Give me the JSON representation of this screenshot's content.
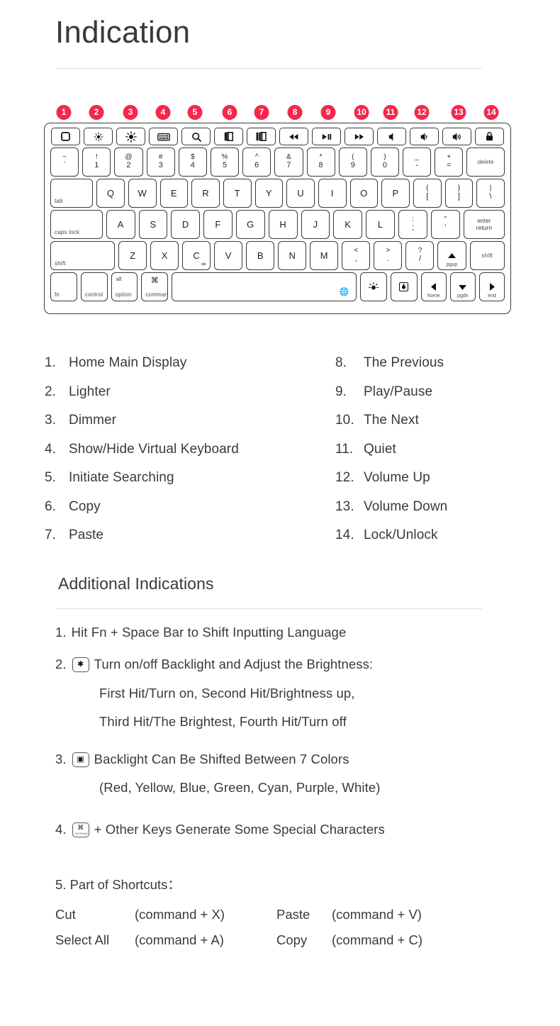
{
  "header": {
    "title": "Indication"
  },
  "badges": [
    "1",
    "2",
    "3",
    "4",
    "5",
    "6",
    "7",
    "8",
    "9",
    "10",
    "11",
    "12",
    "13",
    "14"
  ],
  "keyboard": {
    "function_row": [
      {
        "name": "home-key",
        "icon": "home-square-icon"
      },
      {
        "name": "brightness-down-key",
        "icon": "brightness-small-icon"
      },
      {
        "name": "brightness-up-key",
        "icon": "brightness-large-icon"
      },
      {
        "name": "virtual-keyboard-key",
        "icon": "keyboard-icon"
      },
      {
        "name": "search-key",
        "icon": "search-icon"
      },
      {
        "name": "copy-key",
        "icon": "copy-icon"
      },
      {
        "name": "paste-key",
        "icon": "paste-icon"
      },
      {
        "name": "previous-track-key",
        "icon": "rewind-icon"
      },
      {
        "name": "play-pause-key",
        "icon": "play-pause-icon"
      },
      {
        "name": "next-track-key",
        "icon": "fast-forward-icon"
      },
      {
        "name": "mute-key",
        "icon": "volume-mute-icon"
      },
      {
        "name": "volume-down-key",
        "icon": "volume-low-icon"
      },
      {
        "name": "volume-up-key",
        "icon": "volume-high-icon"
      },
      {
        "name": "lock-key",
        "icon": "lock-icon"
      }
    ],
    "number_row": [
      {
        "up": "~",
        "lo": "`"
      },
      {
        "up": "!",
        "lo": "1"
      },
      {
        "up": "@",
        "lo": "2"
      },
      {
        "up": "#",
        "lo": "3"
      },
      {
        "up": "$",
        "lo": "4"
      },
      {
        "up": "%",
        "lo": "5"
      },
      {
        "up": "^",
        "lo": "6"
      },
      {
        "up": "&",
        "lo": "7"
      },
      {
        "up": "*",
        "lo": "8"
      },
      {
        "up": "(",
        "lo": "9"
      },
      {
        "up": ")",
        "lo": "0"
      },
      {
        "up": "_",
        "lo": "-"
      },
      {
        "up": "+",
        "lo": "="
      }
    ],
    "delete_label": "delete",
    "tab_label": "tab",
    "row_q": [
      "Q",
      "W",
      "E",
      "R",
      "T",
      "Y",
      "U",
      "I",
      "O",
      "P"
    ],
    "row_q_punct": [
      {
        "up": "{",
        "lo": "["
      },
      {
        "up": "}",
        "lo": "]"
      },
      {
        "up": "|",
        "lo": "\\"
      }
    ],
    "caps_label": "caps lock",
    "row_a": [
      "A",
      "S",
      "D",
      "F",
      "G",
      "H",
      "J",
      "K",
      "L"
    ],
    "row_a_punct": [
      {
        "up": ":",
        "lo": ";"
      },
      {
        "up": "\"",
        "lo": "'"
      }
    ],
    "return_top": "enter",
    "return_bottom": "return",
    "shift_left_label": "shift",
    "row_z": [
      "Z",
      "X",
      "C",
      "V",
      "B",
      "N",
      "M"
    ],
    "row_z_punct": [
      {
        "up": "<",
        "lo": ","
      },
      {
        "up": ">",
        "lo": "."
      },
      {
        "up": "?",
        "lo": "/"
      }
    ],
    "pgup_label": "pgup",
    "shift_right_label": "shift",
    "fn_label": "fn",
    "control_label": "control",
    "option_top": "alt",
    "option_label": "option",
    "command_label": "command",
    "home_label": "home",
    "pgdn_label": "pgdn",
    "end_label": "end"
  },
  "indications": {
    "left": [
      {
        "num": "1.",
        "text": "Home Main Display"
      },
      {
        "num": "2.",
        "text": "Lighter"
      },
      {
        "num": "3.",
        "text": "Dimmer"
      },
      {
        "num": "4.",
        "text": "Show/Hide Virtual Keyboard"
      },
      {
        "num": "5.",
        "text": "Initiate Searching"
      },
      {
        "num": "6.",
        "text": "Copy"
      },
      {
        "num": "7.",
        "text": "Paste"
      }
    ],
    "right": [
      {
        "num": "8.",
        "text": "The Previous"
      },
      {
        "num": "9.",
        "text": "Play/Pause"
      },
      {
        "num": "10.",
        "text": "The Next"
      },
      {
        "num": "11.",
        "text": "Quiet"
      },
      {
        "num": "12.",
        "text": "Volume Up"
      },
      {
        "num": "13.",
        "text": "Volume Down"
      },
      {
        "num": "14.",
        "text": "Lock/Unlock"
      }
    ]
  },
  "additional": {
    "title": "Additional Indications",
    "item1_num": "1.",
    "item1_text": "Hit Fn + Space Bar to Shift Inputting Language",
    "item2_num": "2.",
    "item2_text": "Turn on/off Backlight and Adjust the Brightness:",
    "item2_line2": "First Hit/Turn on, Second Hit/Brightness up,",
    "item2_line3": "Third Hit/The Brightest, Fourth Hit/Turn off",
    "item3_num": "3.",
    "item3_text": "Backlight Can Be Shifted Between 7 Colors",
    "item3_line2": "(Red, Yellow, Blue, Green, Cyan, Purple, White)",
    "item4_num": "4.",
    "item4_text": "+ Other Keys Generate Some Special Characters",
    "item5_num": "5.",
    "item5_text": "Part of Shortcuts："
  },
  "shortcuts": [
    {
      "name": "Cut",
      "combo": "(command + X)",
      "name2": "Paste",
      "combo2": "(command + V)"
    },
    {
      "name": "Select All",
      "combo": "(command + A)",
      "name2": "Copy",
      "combo2": "(command + C)"
    }
  ],
  "colors": {
    "badge_red": "#f5274c",
    "text": "#3a3a3a",
    "rule": "#dcdcdc",
    "key_border": "#3a3a3a"
  }
}
